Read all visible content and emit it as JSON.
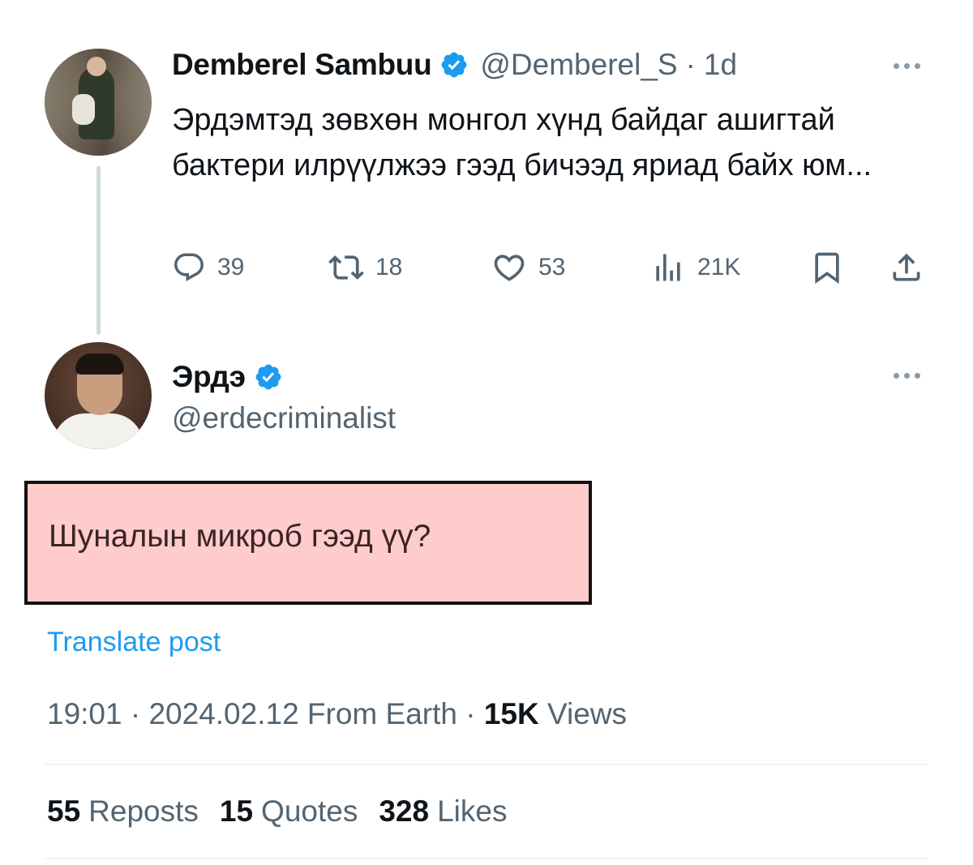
{
  "parent_tweet": {
    "display_name": "Demberel Sambuu",
    "handle": "@Demberel_S",
    "separator": "·",
    "time_ago": "1d",
    "text": "Эрдэмтэд зөвхөн монгол хүнд байдаг ашигтай бактери илрүүлжээ гээд бичээд яриад байх юм...",
    "actions": {
      "replies": "39",
      "reposts": "18",
      "likes": "53",
      "views": "21K"
    }
  },
  "reply_tweet": {
    "display_name": "Эрдэ",
    "handle": "@erdecriminalist",
    "text": "Шуналын микроб гээд үү?",
    "translate_label": "Translate post",
    "timestamp": "19:01 · 2024.02.12 From Earth · ",
    "views_count": "15K",
    "views_label": "Views",
    "stats": {
      "reposts_count": "55",
      "reposts_label": "Reposts",
      "quotes_count": "15",
      "quotes_label": "Quotes",
      "likes_count": "328",
      "likes_label": "Likes"
    }
  },
  "colors": {
    "verified": "#1d9bf0",
    "link": "#1d9bf0",
    "highlight_fill": "#ffcccc",
    "muted_text": "#536471"
  },
  "icons": [
    "reply-icon",
    "repost-icon",
    "like-icon",
    "views-icon",
    "bookmark-icon",
    "share-icon",
    "verified-badge-icon",
    "more-options-icon"
  ]
}
